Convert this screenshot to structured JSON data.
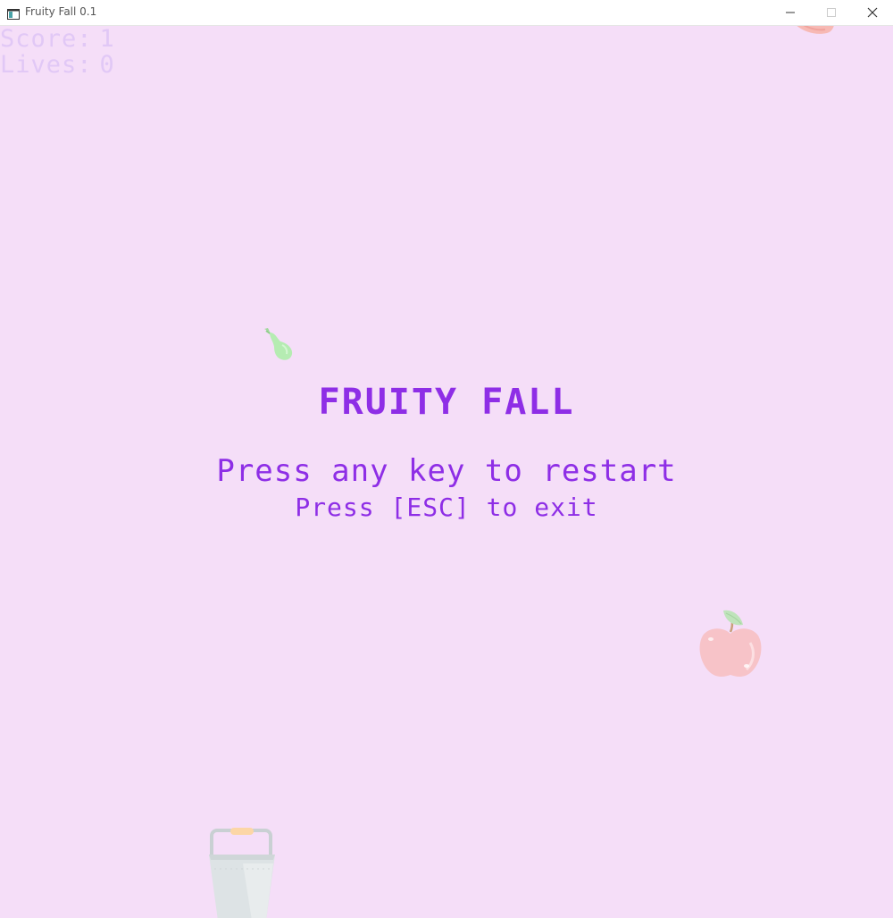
{
  "window": {
    "title": "Fruity Fall 0.1",
    "controls": [
      "minimize-icon",
      "maximize-icon",
      "close-icon"
    ]
  },
  "hud": {
    "score_label": "Score:",
    "score_value": "1",
    "lives_label": "Lives:",
    "lives_value": "0"
  },
  "game_over": {
    "title": "FRUITY FALL",
    "restart_text": "Press any key to restart",
    "exit_text": "Press [ESC] to exit"
  },
  "sprites": [
    "pear-icon",
    "apple-icon",
    "peach-icon",
    "bucket-icon"
  ],
  "colors": {
    "background": "#f5def8",
    "title_text": "#8e2ee6",
    "hud_text": "#e1c8f6",
    "pear": "#b5ecb2",
    "apple": "#f7c3c8",
    "bucket": "#dde3e5"
  }
}
